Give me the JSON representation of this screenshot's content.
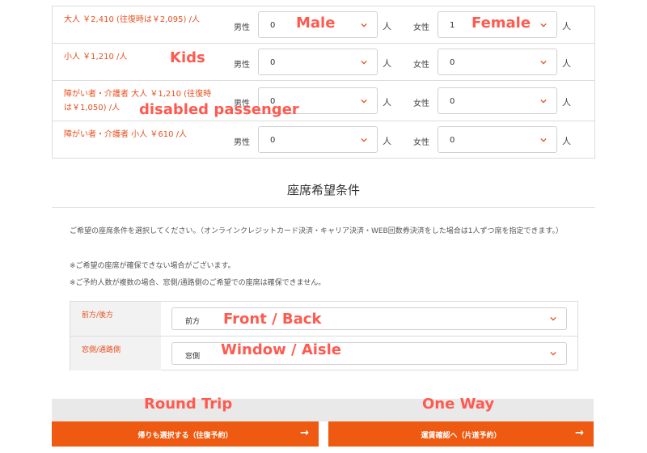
{
  "fares": {
    "male_label": "男性",
    "female_label": "女性",
    "unit": "人",
    "rows": [
      {
        "label": "大人 ￥2,410 (往復時は￥2,095) /人",
        "male": "0",
        "female": "1"
      },
      {
        "label": "小人 ￥1,210 /人",
        "male": "0",
        "female": "0"
      },
      {
        "label": "障がい者・介護者 大人 ￥1,210 (往復時は￥1,050) /人",
        "male": "0",
        "female": "0"
      },
      {
        "label": "障がい者・介護者 小人 ￥610 /人",
        "male": "0",
        "female": "0"
      }
    ]
  },
  "annotations": {
    "male": "Male",
    "female": "Female",
    "kids": "Kids",
    "disabled": "disabled passenger",
    "front_back": "Front / Back",
    "window_aisle": "Window / Aisle",
    "round_trip": "Round Trip",
    "one_way": "One Way"
  },
  "seat": {
    "title": "座席希望条件",
    "note1": "ご希望の座席条件を選択してください。（オンラインクレジットカード決済・キャリア決済・WEB回数券決済をした場合は1人ずつ席を指定できます。）",
    "note2": "※ご希望の座席が確保できない場合がございます。",
    "note3": "※ご予約人数が複数の場合、窓側/通路側のご希望での座席は確保できません。",
    "prefs": [
      {
        "label": "前方/後方",
        "value": "前方"
      },
      {
        "label": "窓側/通路側",
        "value": "窓側"
      }
    ]
  },
  "buttons": {
    "round_trip": "帰りも選択する（往復予約）",
    "one_way": "運賃確認へ（片道予約）",
    "arrow": "→"
  },
  "colors": {
    "accent": "#ef5a12",
    "annotation": "#ff5a4f"
  }
}
